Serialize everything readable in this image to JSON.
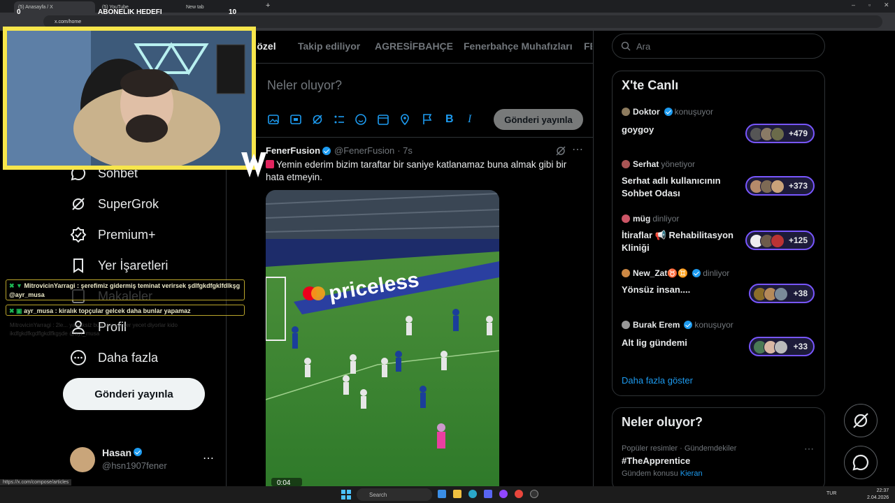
{
  "browser": {
    "tabs": [
      {
        "label": "(5) Anasayfa / X",
        "active": true
      },
      {
        "label": "(5) YouTube",
        "active": false
      },
      {
        "label": "New tab",
        "active": false
      }
    ],
    "url": "x.com/home",
    "status_url": "https://x.com/compose/articles"
  },
  "overlay": {
    "left_counter": "0",
    "goal_label": "ABONELIK HEDEFI",
    "goal_value": "10",
    "chat": [
      {
        "user": "MitrovicinYarragi",
        "text": "MitrovicinYarragi : şerefimiz gidermiş teminat verirsek şdlfgkdfgklfdlkşg @ayr_musa"
      },
      {
        "user": "ayr_musa",
        "text": "ayr_musa : kiralık topçular gelcek daha bunlar yapamaz"
      }
    ],
    "faded_chat": "MitrovicinYarragi : 2le... yarraksiz bu kakisadı ser yecet diyorlar kido ikdfgkdfkgdflgkdlfkgşde @ayr_musa"
  },
  "sidebar": {
    "items": [
      {
        "label": "Sohbet",
        "icon": "chat-icon"
      },
      {
        "label": "SuperGrok",
        "icon": "grok-icon"
      },
      {
        "label": "Premium+",
        "icon": "premium-icon"
      },
      {
        "label": "Yer İşaretleri",
        "icon": "bookmark-icon"
      },
      {
        "label": "Makaleler",
        "icon": "articles-icon"
      },
      {
        "label": "Profil",
        "icon": "profile-icon"
      },
      {
        "label": "Daha fazla",
        "icon": "more-icon"
      }
    ],
    "post_button": "Gönderi yayınla",
    "account": {
      "name": "Hasan",
      "handle": "@hsn1907fener"
    }
  },
  "feed": {
    "tabs": [
      "Sana özel",
      "Takip ediliyor",
      "AGRESİFBAHÇE",
      "Fenerbahçe Muhafızları",
      "FE"
    ],
    "composer_placeholder": "Neler oluyor?",
    "post_button": "Gönderi yayınla",
    "tweet": {
      "author": "FenerFusion",
      "handle": "@FenerFusion",
      "time": "· 7s",
      "text": "Yemin ederim bizim taraftar bir saniye katlanamaz buna almak gibi bir hata etmeyin.",
      "video_board": "priceless",
      "video_time": "0:04"
    }
  },
  "right": {
    "search_placeholder": "Ara",
    "live": {
      "title": "X'te Canlı",
      "spaces": [
        {
          "host": "Doktor",
          "role": "konuşuyor",
          "title": "goygoy",
          "count": "+479"
        },
        {
          "host": "Serhat",
          "role": "yönetiyor",
          "title": "Serhat adlı kullanıcının Sohbet Odası",
          "count": "+373"
        },
        {
          "host": "müg",
          "role": "dinliyor",
          "title": "İtiraflar 📢 Rehabilitasyon Kliniği",
          "count": "+125"
        },
        {
          "host": "New_Zat♉♊",
          "role": "dinliyor",
          "title": "Yönsüz insan....",
          "count": "+38"
        },
        {
          "host": "Burak Erem",
          "role": "konuşuyor",
          "title": "Alt lig gündemi",
          "count": "+33"
        }
      ],
      "show_more": "Daha fazla göster"
    },
    "trends": {
      "title": "Neler oluyor?",
      "meta": "Popüler resimler · Gündemdekiler",
      "hashtag": "#TheApprentice",
      "sub": "Gündem konusu",
      "sub_name": "Kieran"
    }
  },
  "taskbar": {
    "search": "Search",
    "lang": "TUR",
    "time": "22:37",
    "date": "2.04.2026"
  },
  "colors": {
    "accent": "#1d9bf0",
    "live_border": "#7856ff",
    "overlay_yellow": "#f7e64b"
  }
}
